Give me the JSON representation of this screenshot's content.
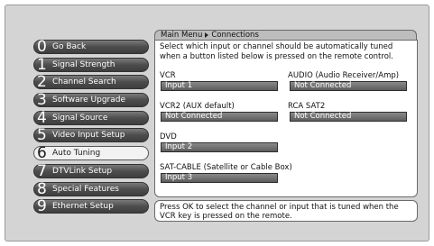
{
  "header": {
    "crumb_root": "Main Menu",
    "crumb_current": "Connections"
  },
  "menu": [
    {
      "num": "0",
      "label": "Go Back"
    },
    {
      "num": "1",
      "label": "Signal Strength"
    },
    {
      "num": "2",
      "label": "Channel Search"
    },
    {
      "num": "3",
      "label": "Software Upgrade"
    },
    {
      "num": "4",
      "label": "Signal Source"
    },
    {
      "num": "5",
      "label": "Video Input Setup"
    },
    {
      "num": "6",
      "label": "Auto Tuning"
    },
    {
      "num": "7",
      "label": "DTVLink Setup"
    },
    {
      "num": "8",
      "label": "Special Features"
    },
    {
      "num": "9",
      "label": "Ethernet Setup"
    }
  ],
  "selected_index": 6,
  "panel": {
    "instructions": "Select which input or channel should be automatically tuned when a button listed below is pressed on the remote control.",
    "fields": {
      "vcr": {
        "label": "VCR",
        "value": "Input 1"
      },
      "audio": {
        "label": "AUDIO (Audio Receiver/Amp)",
        "value": "Not Connected"
      },
      "vcr2": {
        "label": "VCR2 (AUX default)",
        "value": "Not Connected"
      },
      "rca_sat2": {
        "label": "RCA SAT2",
        "value": "Not Connected"
      },
      "dvd": {
        "label": "DVD",
        "value": "Input 2"
      },
      "sat_cable": {
        "label": "SAT-CABLE (Satellite or Cable Box)",
        "value": "Input 3"
      }
    }
  },
  "footer": {
    "text": "Press OK to select the channel or input that is tuned when the VCR key is pressed on the remote."
  },
  "colors": {
    "background": "#d4d4d4",
    "menu_button": "#4d4d4d",
    "selected_button": "#f2f2f2",
    "field_box": "#6e6e6e"
  }
}
